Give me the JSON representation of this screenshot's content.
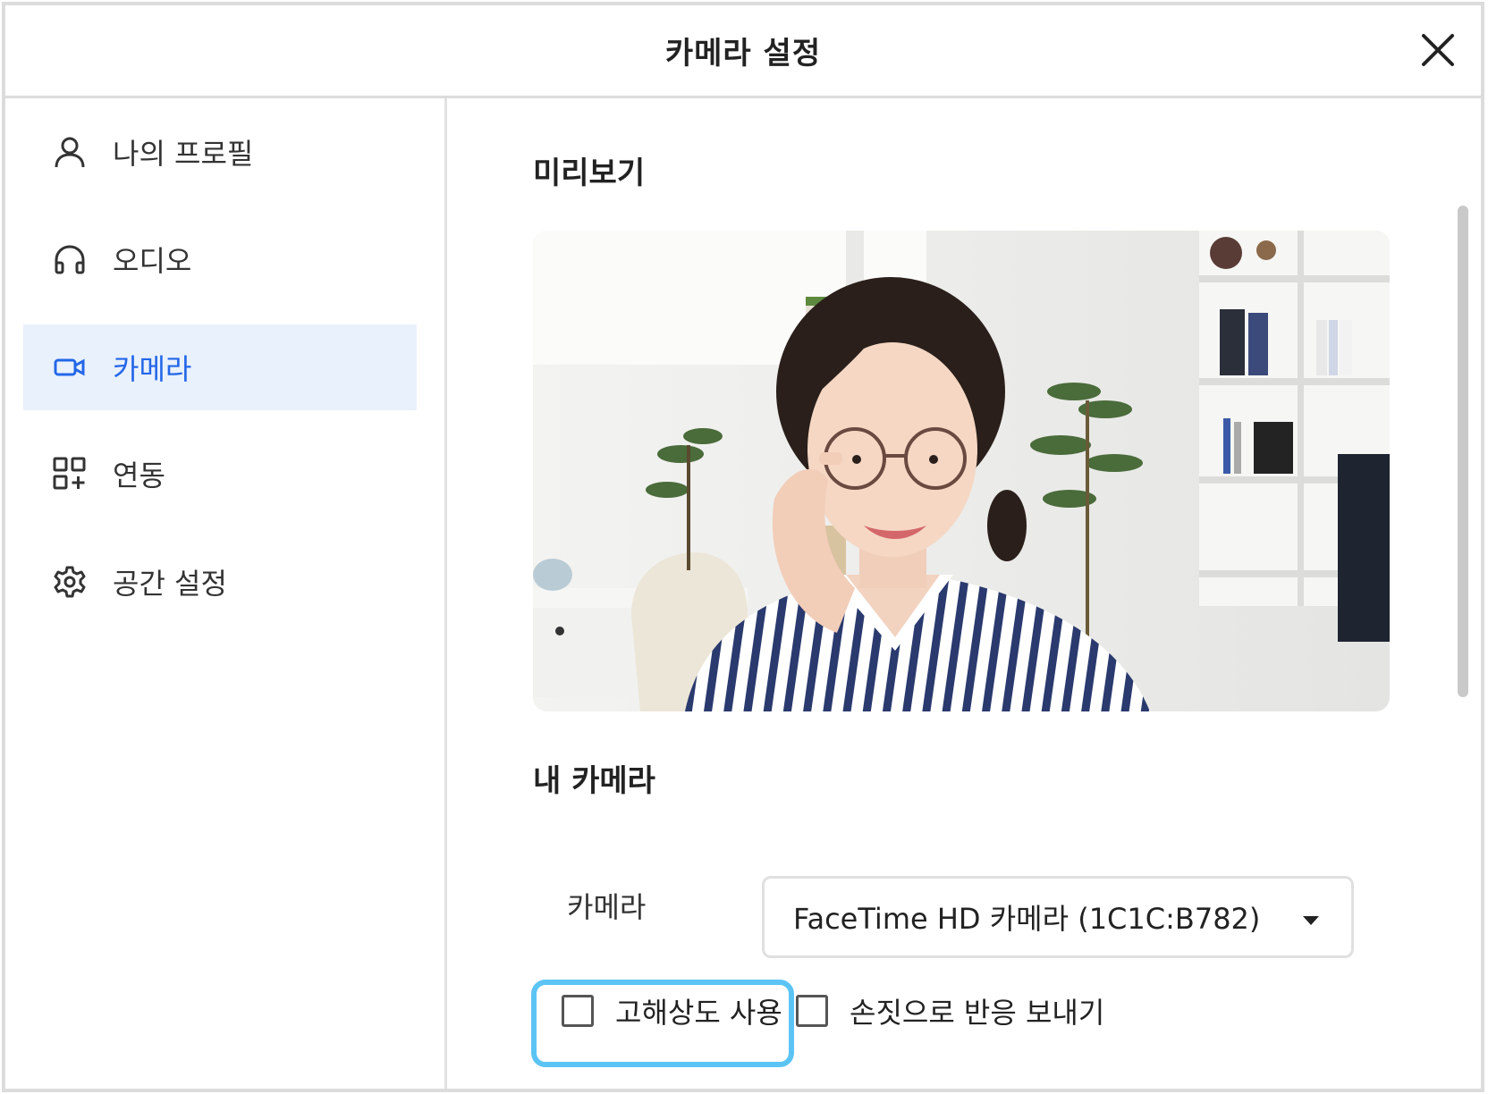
{
  "dialog": {
    "title": "카메라 설정",
    "close_icon": "close-icon"
  },
  "sidebar": {
    "items": [
      {
        "label": "나의 프로필",
        "icon": "person-icon",
        "active": false
      },
      {
        "label": "오디오",
        "icon": "headphones-icon",
        "active": false
      },
      {
        "label": "카메라",
        "icon": "video-camera-icon",
        "active": true
      },
      {
        "label": "연동",
        "icon": "apps-add-icon",
        "active": false
      },
      {
        "label": "공간 설정",
        "icon": "gear-icon",
        "active": false
      }
    ]
  },
  "main": {
    "preview_title": "미리보기",
    "my_camera_title": "내 카메라",
    "camera_label": "카메라",
    "camera_select_value": "FaceTime HD 카메라 (1C1C:B782)",
    "checkboxes": [
      {
        "label": "고해상도 사용",
        "checked": false,
        "highlighted": true
      },
      {
        "label": "손짓으로 반응 보내기",
        "checked": false,
        "highlighted": false
      }
    ]
  },
  "colors": {
    "accent": "#2367e8",
    "active_bg": "#e9f1fd",
    "highlight": "#5cc4f5"
  }
}
